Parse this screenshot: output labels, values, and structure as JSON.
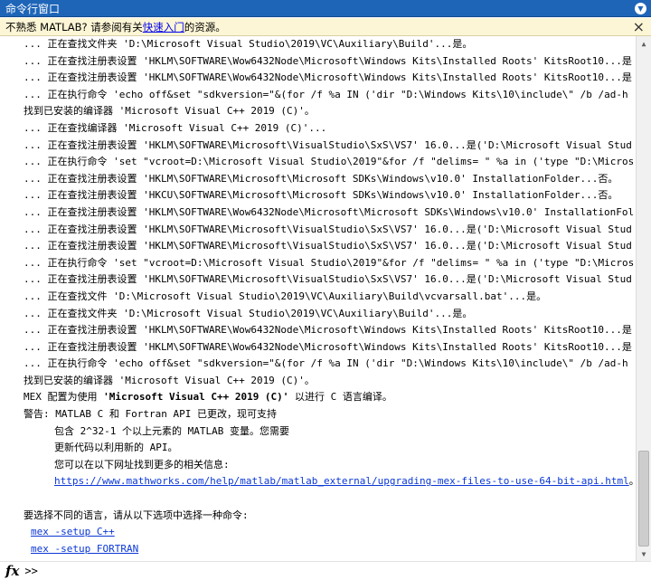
{
  "window": {
    "title": "命令行窗口",
    "menu_icon": "chevron-down-icon"
  },
  "notice": {
    "prefix": "不熟悉 MATLAB? 请参阅有关",
    "link": "快速入门",
    "suffix": "的资源。",
    "close": "×"
  },
  "lines": [
    "... 正在查找文件夹 'D:\\Microsoft Visual Studio\\2019\\VC\\Auxiliary\\Build'...是。",
    "... 正在查找注册表设置 'HKLM\\SOFTWARE\\Wow6432Node\\Microsoft\\Windows Kits\\Installed Roots' KitsRoot10...是",
    "... 正在查找注册表设置 'HKLM\\SOFTWARE\\Wow6432Node\\Microsoft\\Windows Kits\\Installed Roots' KitsRoot10...是",
    "... 正在执行命令 'echo off&set \"sdkversion=\"&(for /f %a IN ('dir \"D:\\Windows Kits\\10\\include\\\" /b /ad-h",
    "找到已安装的编译器 'Microsoft Visual C++ 2019 (C)'。",
    "... 正在查找编译器 'Microsoft Visual C++ 2019 (C)'...",
    "... 正在查找注册表设置 'HKLM\\SOFTWARE\\Microsoft\\VisualStudio\\SxS\\VS7' 16.0...是('D:\\Microsoft Visual Stud",
    "... 正在执行命令 'set \"vcroot=D:\\Microsoft Visual Studio\\2019\"&for /f \"delims= \" %a in ('type \"D:\\Micros",
    "... 正在查找注册表设置 'HKLM\\SOFTWARE\\Microsoft\\Microsoft SDKs\\Windows\\v10.0' InstallationFolder...否。",
    "... 正在查找注册表设置 'HKCU\\SOFTWARE\\Microsoft\\Microsoft SDKs\\Windows\\v10.0' InstallationFolder...否。",
    "... 正在查找注册表设置 'HKLM\\SOFTWARE\\Wow6432Node\\Microsoft\\Microsoft SDKs\\Windows\\v10.0' InstallationFol",
    "... 正在查找注册表设置 'HKLM\\SOFTWARE\\Microsoft\\VisualStudio\\SxS\\VS7' 16.0...是('D:\\Microsoft Visual Stud",
    "... 正在查找注册表设置 'HKLM\\SOFTWARE\\Microsoft\\VisualStudio\\SxS\\VS7' 16.0...是('D:\\Microsoft Visual Stud",
    "... 正在执行命令 'set \"vcroot=D:\\Microsoft Visual Studio\\2019\"&for /f \"delims= \" %a in ('type \"D:\\Micros",
    "... 正在查找注册表设置 'HKLM\\SOFTWARE\\Microsoft\\VisualStudio\\SxS\\VS7' 16.0...是('D:\\Microsoft Visual Stud",
    "... 正在查找文件 'D:\\Microsoft Visual Studio\\2019\\VC\\Auxiliary\\Build\\vcvarsall.bat'...是。",
    "... 正在查找文件夹 'D:\\Microsoft Visual Studio\\2019\\VC\\Auxiliary\\Build'...是。",
    "... 正在查找注册表设置 'HKLM\\SOFTWARE\\Wow6432Node\\Microsoft\\Windows Kits\\Installed Roots' KitsRoot10...是",
    "... 正在查找注册表设置 'HKLM\\SOFTWARE\\Wow6432Node\\Microsoft\\Windows Kits\\Installed Roots' KitsRoot10...是",
    "... 正在执行命令 'echo off&set \"sdkversion=\"&(for /f %a IN ('dir \"D:\\Windows Kits\\10\\include\\\" /b /ad-h",
    "找到已安装的编译器 'Microsoft Visual C++ 2019 (C)'。"
  ],
  "mex": {
    "prefix": "MEX 配置为使用 ",
    "compiler": "'Microsoft Visual C++ 2019 (C)'",
    "suffix": " 以进行 C 语言编译。"
  },
  "warning": {
    "first": "警告: MATLAB C 和 Fortran API 已更改，现可支持",
    "l2": "包含 2^32-1 个以上元素的 MATLAB 变量。您需要",
    "l3": "更新代码以利用新的 API。",
    "l4": "您可以在以下网址找到更多的相关信息:",
    "url": "https://www.mathworks.com/help/matlab/matlab_external/upgrading-mex-files-to-use-64-bit-api.html",
    "url_suffix": "。"
  },
  "choose": {
    "text": "要选择不同的语言，请从以下选项中选择一种命令:",
    "opt1": "mex -setup C++",
    "opt2": "mex -setup FORTRAN"
  },
  "prompt": {
    "fx": "fx",
    "symbol": ">>",
    "value": ""
  }
}
